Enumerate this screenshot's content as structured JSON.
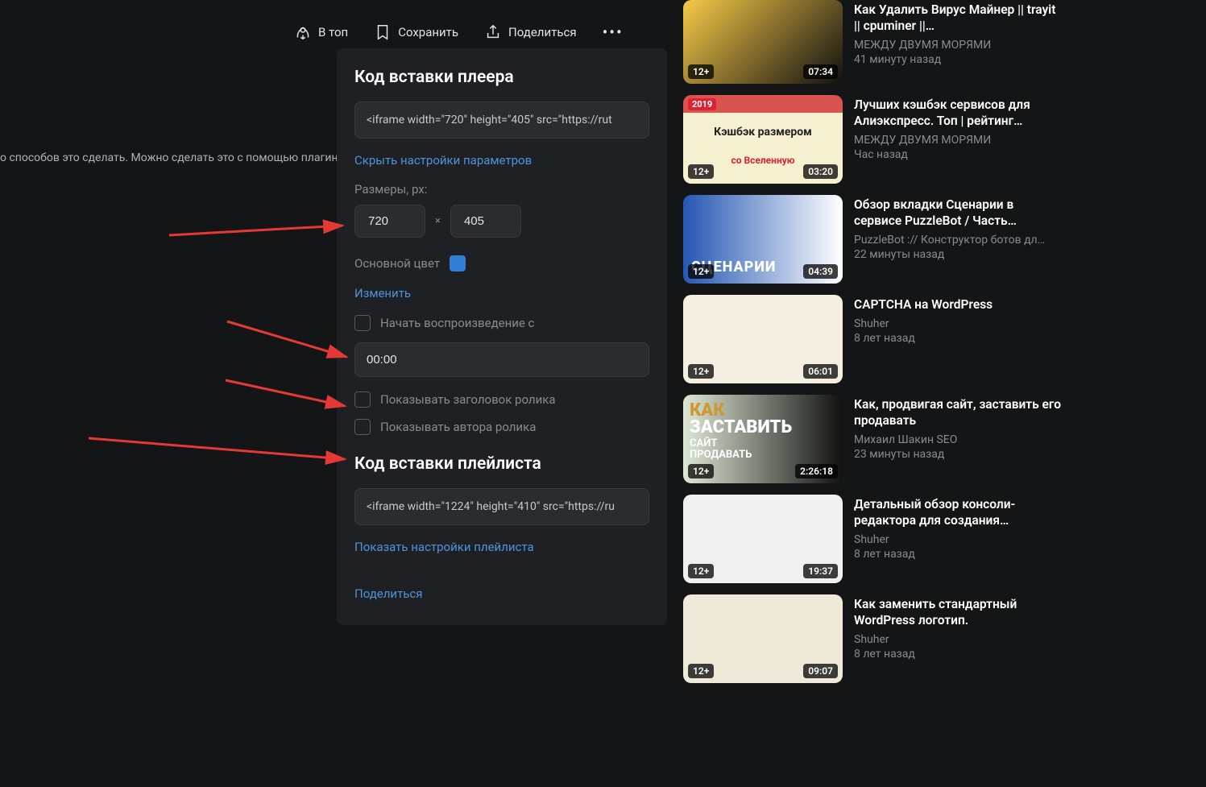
{
  "actions": {
    "top": "В топ",
    "save": "Сохранить",
    "share": "Поделиться"
  },
  "description": "о способов это сделать. Можно сделать это с помощью плагин",
  "popup": {
    "title1": "Код вставки плеера",
    "code1": "<iframe width=\"720\" height=\"405\" src=\"https://rut",
    "hide_settings": "Скрыть настройки параметров",
    "sizes_label": "Размеры, px:",
    "width": "720",
    "sep": "×",
    "height": "405",
    "color_label": "Основной цвет",
    "change": "Изменить",
    "chk_start": "Начать воспроизведение с",
    "start_time": "00:00",
    "chk_title": "Показывать заголовок ролика",
    "chk_author": "Показывать автора ролика",
    "title2": "Код вставки плейлиста",
    "code2": "<iframe width=\"1224\" height=\"410\" src=\"https://ru",
    "show_playlist": "Показать настройки плейлиста",
    "share": "Поделиться"
  },
  "videos": [
    {
      "title": "Как Удалить Вирус Майнер || trayit || cpuminer ||…",
      "channel": "МЕЖДУ ДВУМЯ МОРЯМИ",
      "time": "41 минуту назад",
      "age": "12+",
      "dur": "07:34"
    },
    {
      "title": "Лучших кэшбэк сервисов для Алиэкспресс. Топ | рейтинг…",
      "channel": "МЕЖДУ ДВУМЯ МОРЯМИ",
      "time": "Час назад",
      "age": "12+",
      "dur": "03:20",
      "year": "2019",
      "tagline1": "Кэшбэк размером",
      "tagline2": "со Вселенную"
    },
    {
      "title": "Обзор вкладки Сценарии в сервисе PuzzleBot / Часть…",
      "channel": "PuzzleBot :// Конструктор ботов дл…",
      "time": "22 минуты назад",
      "age": "12+",
      "dur": "04:39",
      "thumb_text": "СЦЕНАРИИ"
    },
    {
      "title": "CAPTCHA на WordPress",
      "channel": "Shuher",
      "time": "8 лет назад",
      "age": "12+",
      "dur": "06:01"
    },
    {
      "title": "Как, продвигая сайт, заставить его продавать",
      "channel": "Михаил Шакин SEO",
      "time": "23 минуты назад",
      "age": "12+",
      "dur": "2:26:18",
      "tt1": "КАК",
      "tt2": "ЗАСТАВИТЬ",
      "tt3": "САЙТ",
      "tt4": "ПРОДАВАТЬ"
    },
    {
      "title": "Детальный обзор консоли-редактора для создания…",
      "channel": "Shuher",
      "time": "8 лет назад",
      "age": "12+",
      "dur": "19:37"
    },
    {
      "title": "Как заменить стандартный WordPress логотип.",
      "channel": "Shuher",
      "time": "8 лет назад",
      "age": "12+",
      "dur": "09:07"
    }
  ]
}
